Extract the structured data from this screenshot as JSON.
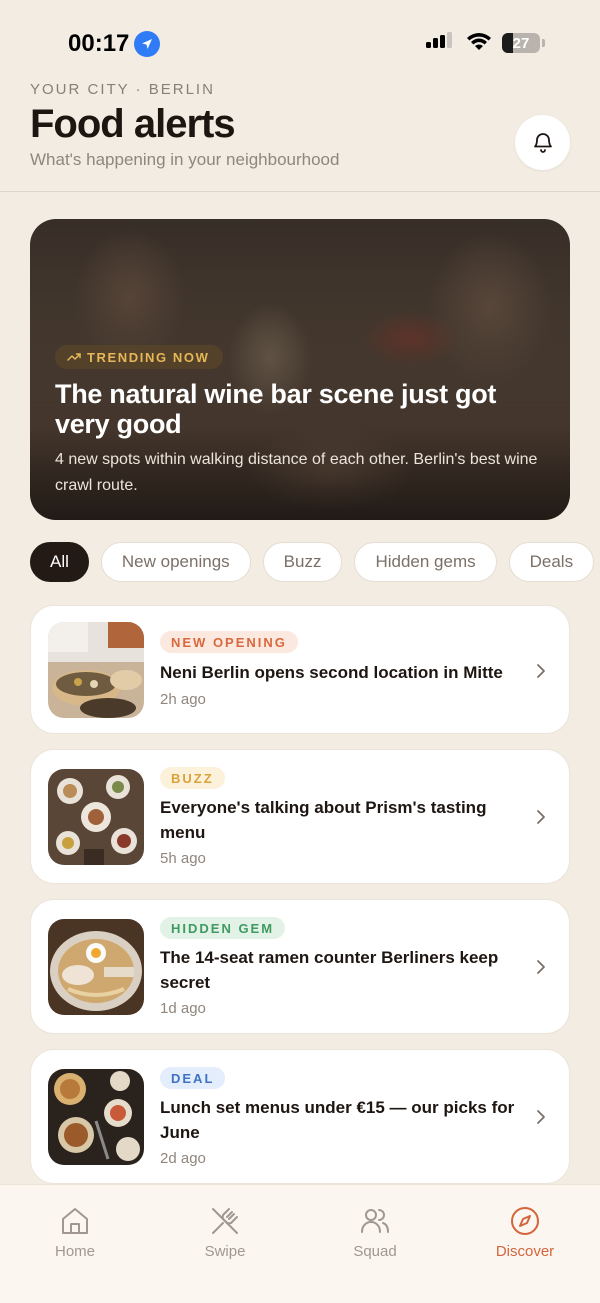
{
  "status_bar": {
    "time": "00:17",
    "battery": "27"
  },
  "header": {
    "eyebrow": "YOUR CITY · BERLIN",
    "title": "Food alerts",
    "subtitle": "What's happening in your neighbourhood",
    "bell_icon": "bell-icon"
  },
  "hero": {
    "badge": "TRENDING NOW",
    "title": "The natural wine bar scene just got very good",
    "body": "4 new spots within walking distance of each other. Berlin's best wine crawl route."
  },
  "filters": [
    "All",
    "New openings",
    "Buzz",
    "Hidden gems",
    "Deals"
  ],
  "active_filter": "All",
  "alerts": [
    {
      "tag": "NEW OPENING",
      "title": "Neni Berlin opens second location in Mitte",
      "time": "2h ago"
    },
    {
      "tag": "BUZZ",
      "title": "Everyone's talking about Prism's tasting menu",
      "time": "5h ago"
    },
    {
      "tag": "HIDDEN GEM",
      "title": "The 14-seat ramen counter Berliners keep secret",
      "time": "1d ago"
    },
    {
      "tag": "DEAL",
      "title": "Lunch set menus under €15 — our picks for June",
      "time": "2d ago"
    }
  ],
  "nav": {
    "home": "Home",
    "swipe": "Swipe",
    "squad": "Squad",
    "discover": "Discover",
    "active": "Discover"
  },
  "colors": {
    "accent": "#d4643c",
    "dark": "#241a15",
    "background": "#f3ece3",
    "tag_new_opening": "#d9683e",
    "tag_buzz": "#d9a23a",
    "tag_hidden_gem": "#3f9a62",
    "tag_deal": "#3f72c4"
  }
}
